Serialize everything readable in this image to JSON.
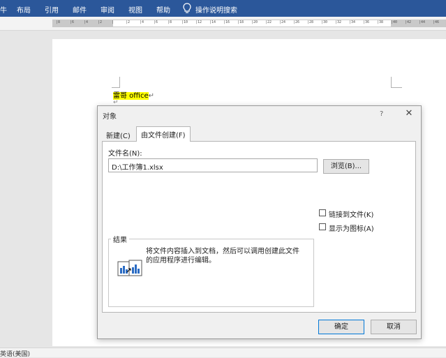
{
  "menubar": {
    "items": [
      "牛",
      "布局",
      "引用",
      "邮件",
      "审阅",
      "视图",
      "帮助"
    ],
    "tell_me": "操作说明搜索"
  },
  "ruler": {
    "ticks": [
      "8",
      "6",
      "4",
      "2",
      "",
      "2",
      "4",
      "6",
      "8",
      "10",
      "12",
      "14",
      "16",
      "18",
      "20",
      "22",
      "24",
      "26",
      "28",
      "30",
      "32",
      "34",
      "36",
      "38",
      "40",
      "42",
      "44",
      "46"
    ]
  },
  "document": {
    "highlighted_text": "雷哥 office",
    "paragraph_mark": "↵",
    "highlight_color": "#ffff00"
  },
  "statusbar": {
    "language": "英语(美国)"
  },
  "dialog": {
    "title": "对象",
    "help_glyph": "?",
    "close_glyph": "✕",
    "tabs": [
      {
        "label": "新建(C)",
        "active": false
      },
      {
        "label": "由文件创建(F)",
        "active": true
      }
    ],
    "filename_label": "文件名(N):",
    "filename_value": "D:\\工作簿1.xlsx",
    "browse_label": "浏览(B)...",
    "link_checkbox_label": "链接到文件(K)",
    "link_checked": false,
    "icon_checkbox_label": "显示为图标(A)",
    "icon_checked": false,
    "result_legend": "结果",
    "result_text": "将文件内容插入到文档，然后可以调用创建此文件的应用程序进行编辑。",
    "ok_label": "确定",
    "cancel_label": "取消"
  },
  "colors": {
    "ribbon": "#2b579a",
    "ok_border": "#0078d7"
  }
}
